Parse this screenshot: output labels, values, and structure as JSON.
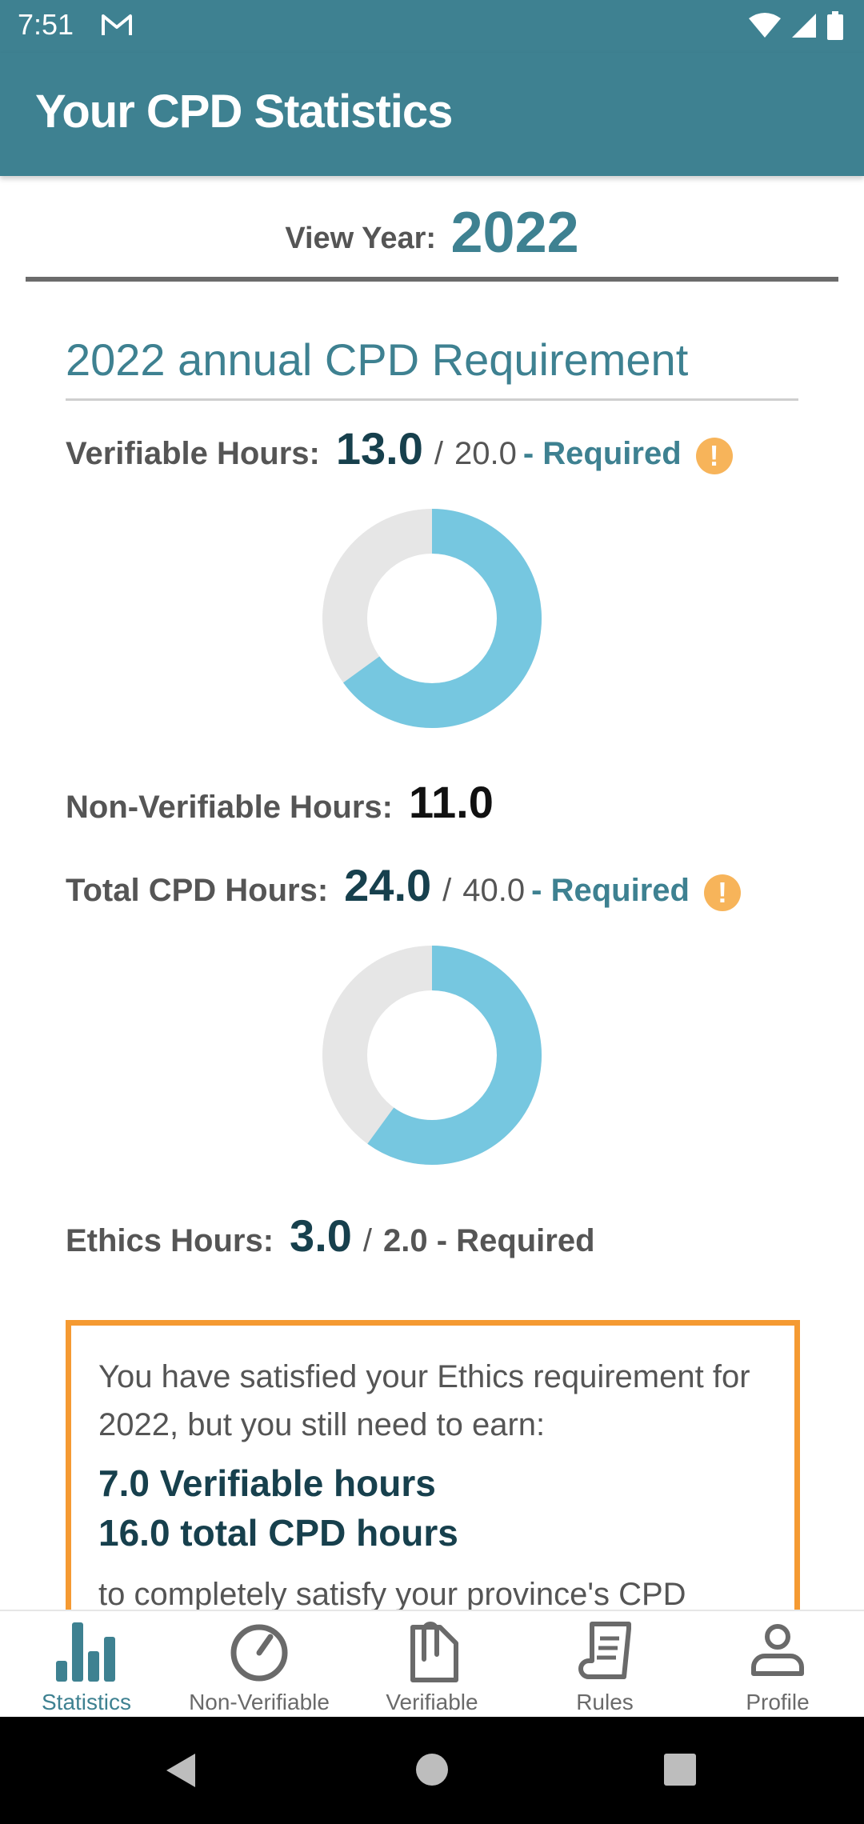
{
  "status_bar": {
    "time": "7:51"
  },
  "app_bar": {
    "title": "Your CPD Statistics"
  },
  "view_year": {
    "label": "View Year:",
    "value": "2022"
  },
  "section": {
    "title": "2022 annual CPD Requirement"
  },
  "verifiable": {
    "label": "Verifiable Hours:",
    "value": "13.0",
    "separator": "/",
    "required": "20.0",
    "required_label": "- Required",
    "progress_fraction": 0.65
  },
  "non_verifiable": {
    "label": "Non-Verifiable Hours:",
    "value": "11.0"
  },
  "total": {
    "label": "Total CPD Hours:",
    "value": "24.0",
    "separator": "/",
    "required": "40.0",
    "required_label": "- Required",
    "progress_fraction": 0.6
  },
  "ethics": {
    "label": "Ethics Hours:",
    "value": "3.0",
    "separator": "/",
    "required": "2.0 - Required"
  },
  "notice": {
    "text": "You have satisfied your Ethics requirement for 2022, but you still need to earn:",
    "verifiable_needed": "7.0 Verifiable hours",
    "total_needed": "16.0 total CPD hours",
    "trailing": "to completely satisfy your province's CPD"
  },
  "bottom_nav": [
    {
      "label": "Statistics",
      "icon": "bar-chart-icon",
      "active": true
    },
    {
      "label": "Non-Verifiable",
      "icon": "timer-icon",
      "active": false
    },
    {
      "label": "Verifiable",
      "icon": "attachment-doc-icon",
      "active": false
    },
    {
      "label": "Rules",
      "icon": "rules-doc-icon",
      "active": false
    },
    {
      "label": "Profile",
      "icon": "person-icon",
      "active": false
    }
  ],
  "colors": {
    "primary": "#3e8191",
    "donut_fill": "#76c7e0",
    "donut_track": "#e6e6e6",
    "warning": "#f7b45a",
    "notice_border": "#f59a32"
  }
}
